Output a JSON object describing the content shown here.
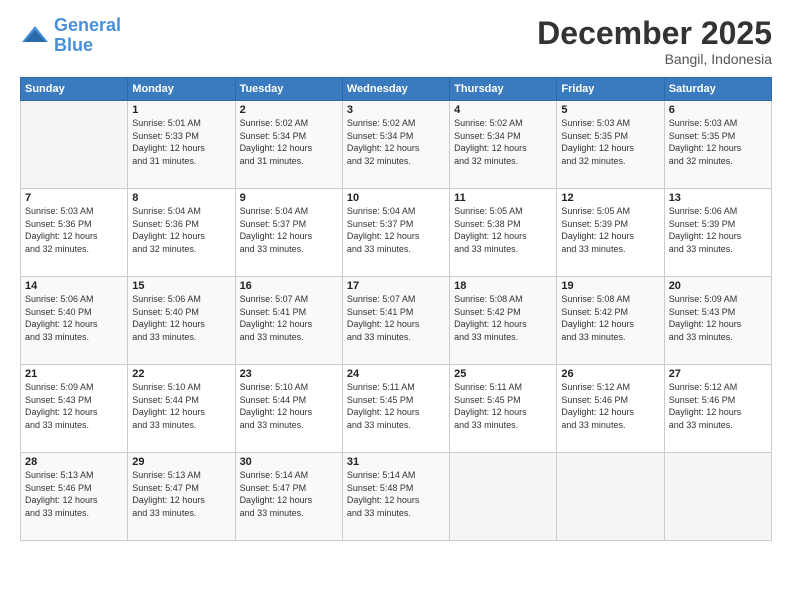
{
  "logo": {
    "line1": "General",
    "line2": "Blue"
  },
  "title": "December 2025",
  "subtitle": "Bangil, Indonesia",
  "days_header": [
    "Sunday",
    "Monday",
    "Tuesday",
    "Wednesday",
    "Thursday",
    "Friday",
    "Saturday"
  ],
  "weeks": [
    [
      {
        "day": "",
        "info": ""
      },
      {
        "day": "1",
        "info": "Sunrise: 5:01 AM\nSunset: 5:33 PM\nDaylight: 12 hours\nand 31 minutes."
      },
      {
        "day": "2",
        "info": "Sunrise: 5:02 AM\nSunset: 5:34 PM\nDaylight: 12 hours\nand 31 minutes."
      },
      {
        "day": "3",
        "info": "Sunrise: 5:02 AM\nSunset: 5:34 PM\nDaylight: 12 hours\nand 32 minutes."
      },
      {
        "day": "4",
        "info": "Sunrise: 5:02 AM\nSunset: 5:34 PM\nDaylight: 12 hours\nand 32 minutes."
      },
      {
        "day": "5",
        "info": "Sunrise: 5:03 AM\nSunset: 5:35 PM\nDaylight: 12 hours\nand 32 minutes."
      },
      {
        "day": "6",
        "info": "Sunrise: 5:03 AM\nSunset: 5:35 PM\nDaylight: 12 hours\nand 32 minutes."
      }
    ],
    [
      {
        "day": "7",
        "info": "Sunrise: 5:03 AM\nSunset: 5:36 PM\nDaylight: 12 hours\nand 32 minutes."
      },
      {
        "day": "8",
        "info": "Sunrise: 5:04 AM\nSunset: 5:36 PM\nDaylight: 12 hours\nand 32 minutes."
      },
      {
        "day": "9",
        "info": "Sunrise: 5:04 AM\nSunset: 5:37 PM\nDaylight: 12 hours\nand 33 minutes."
      },
      {
        "day": "10",
        "info": "Sunrise: 5:04 AM\nSunset: 5:37 PM\nDaylight: 12 hours\nand 33 minutes."
      },
      {
        "day": "11",
        "info": "Sunrise: 5:05 AM\nSunset: 5:38 PM\nDaylight: 12 hours\nand 33 minutes."
      },
      {
        "day": "12",
        "info": "Sunrise: 5:05 AM\nSunset: 5:39 PM\nDaylight: 12 hours\nand 33 minutes."
      },
      {
        "day": "13",
        "info": "Sunrise: 5:06 AM\nSunset: 5:39 PM\nDaylight: 12 hours\nand 33 minutes."
      }
    ],
    [
      {
        "day": "14",
        "info": "Sunrise: 5:06 AM\nSunset: 5:40 PM\nDaylight: 12 hours\nand 33 minutes."
      },
      {
        "day": "15",
        "info": "Sunrise: 5:06 AM\nSunset: 5:40 PM\nDaylight: 12 hours\nand 33 minutes."
      },
      {
        "day": "16",
        "info": "Sunrise: 5:07 AM\nSunset: 5:41 PM\nDaylight: 12 hours\nand 33 minutes."
      },
      {
        "day": "17",
        "info": "Sunrise: 5:07 AM\nSunset: 5:41 PM\nDaylight: 12 hours\nand 33 minutes."
      },
      {
        "day": "18",
        "info": "Sunrise: 5:08 AM\nSunset: 5:42 PM\nDaylight: 12 hours\nand 33 minutes."
      },
      {
        "day": "19",
        "info": "Sunrise: 5:08 AM\nSunset: 5:42 PM\nDaylight: 12 hours\nand 33 minutes."
      },
      {
        "day": "20",
        "info": "Sunrise: 5:09 AM\nSunset: 5:43 PM\nDaylight: 12 hours\nand 33 minutes."
      }
    ],
    [
      {
        "day": "21",
        "info": "Sunrise: 5:09 AM\nSunset: 5:43 PM\nDaylight: 12 hours\nand 33 minutes."
      },
      {
        "day": "22",
        "info": "Sunrise: 5:10 AM\nSunset: 5:44 PM\nDaylight: 12 hours\nand 33 minutes."
      },
      {
        "day": "23",
        "info": "Sunrise: 5:10 AM\nSunset: 5:44 PM\nDaylight: 12 hours\nand 33 minutes."
      },
      {
        "day": "24",
        "info": "Sunrise: 5:11 AM\nSunset: 5:45 PM\nDaylight: 12 hours\nand 33 minutes."
      },
      {
        "day": "25",
        "info": "Sunrise: 5:11 AM\nSunset: 5:45 PM\nDaylight: 12 hours\nand 33 minutes."
      },
      {
        "day": "26",
        "info": "Sunrise: 5:12 AM\nSunset: 5:46 PM\nDaylight: 12 hours\nand 33 minutes."
      },
      {
        "day": "27",
        "info": "Sunrise: 5:12 AM\nSunset: 5:46 PM\nDaylight: 12 hours\nand 33 minutes."
      }
    ],
    [
      {
        "day": "28",
        "info": "Sunrise: 5:13 AM\nSunset: 5:46 PM\nDaylight: 12 hours\nand 33 minutes."
      },
      {
        "day": "29",
        "info": "Sunrise: 5:13 AM\nSunset: 5:47 PM\nDaylight: 12 hours\nand 33 minutes."
      },
      {
        "day": "30",
        "info": "Sunrise: 5:14 AM\nSunset: 5:47 PM\nDaylight: 12 hours\nand 33 minutes."
      },
      {
        "day": "31",
        "info": "Sunrise: 5:14 AM\nSunset: 5:48 PM\nDaylight: 12 hours\nand 33 minutes."
      },
      {
        "day": "",
        "info": ""
      },
      {
        "day": "",
        "info": ""
      },
      {
        "day": "",
        "info": ""
      }
    ]
  ]
}
